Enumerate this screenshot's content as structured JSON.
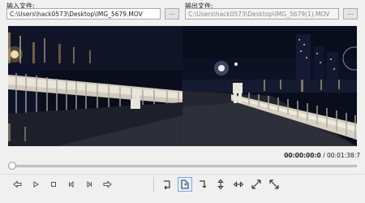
{
  "input": {
    "label": "输入文件:",
    "value": "C:\\Users\\hack0573\\Desktop\\IMG_5679.MOV",
    "browse_label": "..."
  },
  "output": {
    "label": "输出文件:",
    "value": "C:\\Users\\hack0573\\Desktop\\IMG_5679(1).MOV",
    "browse_label": "..."
  },
  "time": {
    "current": "00:00:00:0",
    "separator": " / ",
    "total": "00:01:38:7"
  },
  "playback": {
    "progress": 0.0
  },
  "colors": {
    "video_bg": "#0b0b0d",
    "sky": "#0a0d1c",
    "accent": "#2a6ebf"
  },
  "icons": {
    "player": [
      "rewind-icon",
      "play-icon",
      "stop-icon",
      "previous-frame-icon",
      "next-frame-icon",
      "forward-icon"
    ],
    "transform": [
      "rotate-left-icon",
      "rotate-right-icon",
      "rotate-180-icon",
      "flip-vertical-icon",
      "flip-horizontal-icon",
      "transpose-icon",
      "transverse-icon"
    ]
  }
}
